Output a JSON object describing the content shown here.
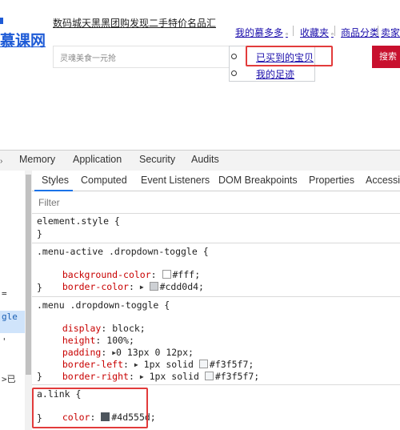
{
  "site": {
    "logo": "慕课网",
    "category_link": "数码城天黑黑团购发现二手特价名品汇",
    "nav": {
      "my_account": "我的慕多多",
      "favorites": "收藏夹",
      "categories": "商品分类",
      "seller": "卖家"
    },
    "search_placeholder": "灵魂美食一元抢",
    "search_button": "搜索",
    "dropdown_items": [
      "已买到的宝贝",
      "我的足迹"
    ]
  },
  "devtools": {
    "main_tabs": [
      "Memory",
      "Application",
      "Security",
      "Audits"
    ],
    "sub_tabs": [
      "Styles",
      "Computed",
      "Event Listeners",
      "DOM Breakpoints",
      "Properties",
      "Accessibil"
    ],
    "active_sub_tab": "Styles",
    "filter_placeholder": "Filter",
    "left_fragments": [
      "=",
      "gle",
      "'",
      ">已"
    ],
    "rules": [
      {
        "selector": "element.style {",
        "close": "}"
      },
      {
        "selector": ".menu-active .dropdown-toggle {",
        "decls": [
          {
            "prop": "background-color",
            "value": "#fff;"
          },
          {
            "prop": "border-color",
            "value": "#cdd0d4;"
          }
        ],
        "close": "}"
      },
      {
        "selector": ".menu .dropdown-toggle {",
        "decls": [
          {
            "prop": "display",
            "value": "block;"
          },
          {
            "prop": "height",
            "value": "100%;"
          },
          {
            "prop": "padding",
            "value": "0 13px 0 12px;"
          },
          {
            "prop": "border-left",
            "value": "1px solid #f3f5f7;"
          },
          {
            "prop": "border-right",
            "value": "1px solid #f3f5f7;"
          }
        ],
        "close": "}"
      },
      {
        "selector": "a.link {",
        "decls": [
          {
            "prop": "color",
            "value": "#4d555d;"
          }
        ],
        "close": "}"
      }
    ]
  },
  "colors": {
    "swatch_white": "#ffffff",
    "swatch_border": "#cdd0d4",
    "swatch_f3": "#f3f5f7",
    "swatch_link": "#4d555d",
    "highlight_red": "#e23b3b",
    "search_red": "#c8102e"
  }
}
